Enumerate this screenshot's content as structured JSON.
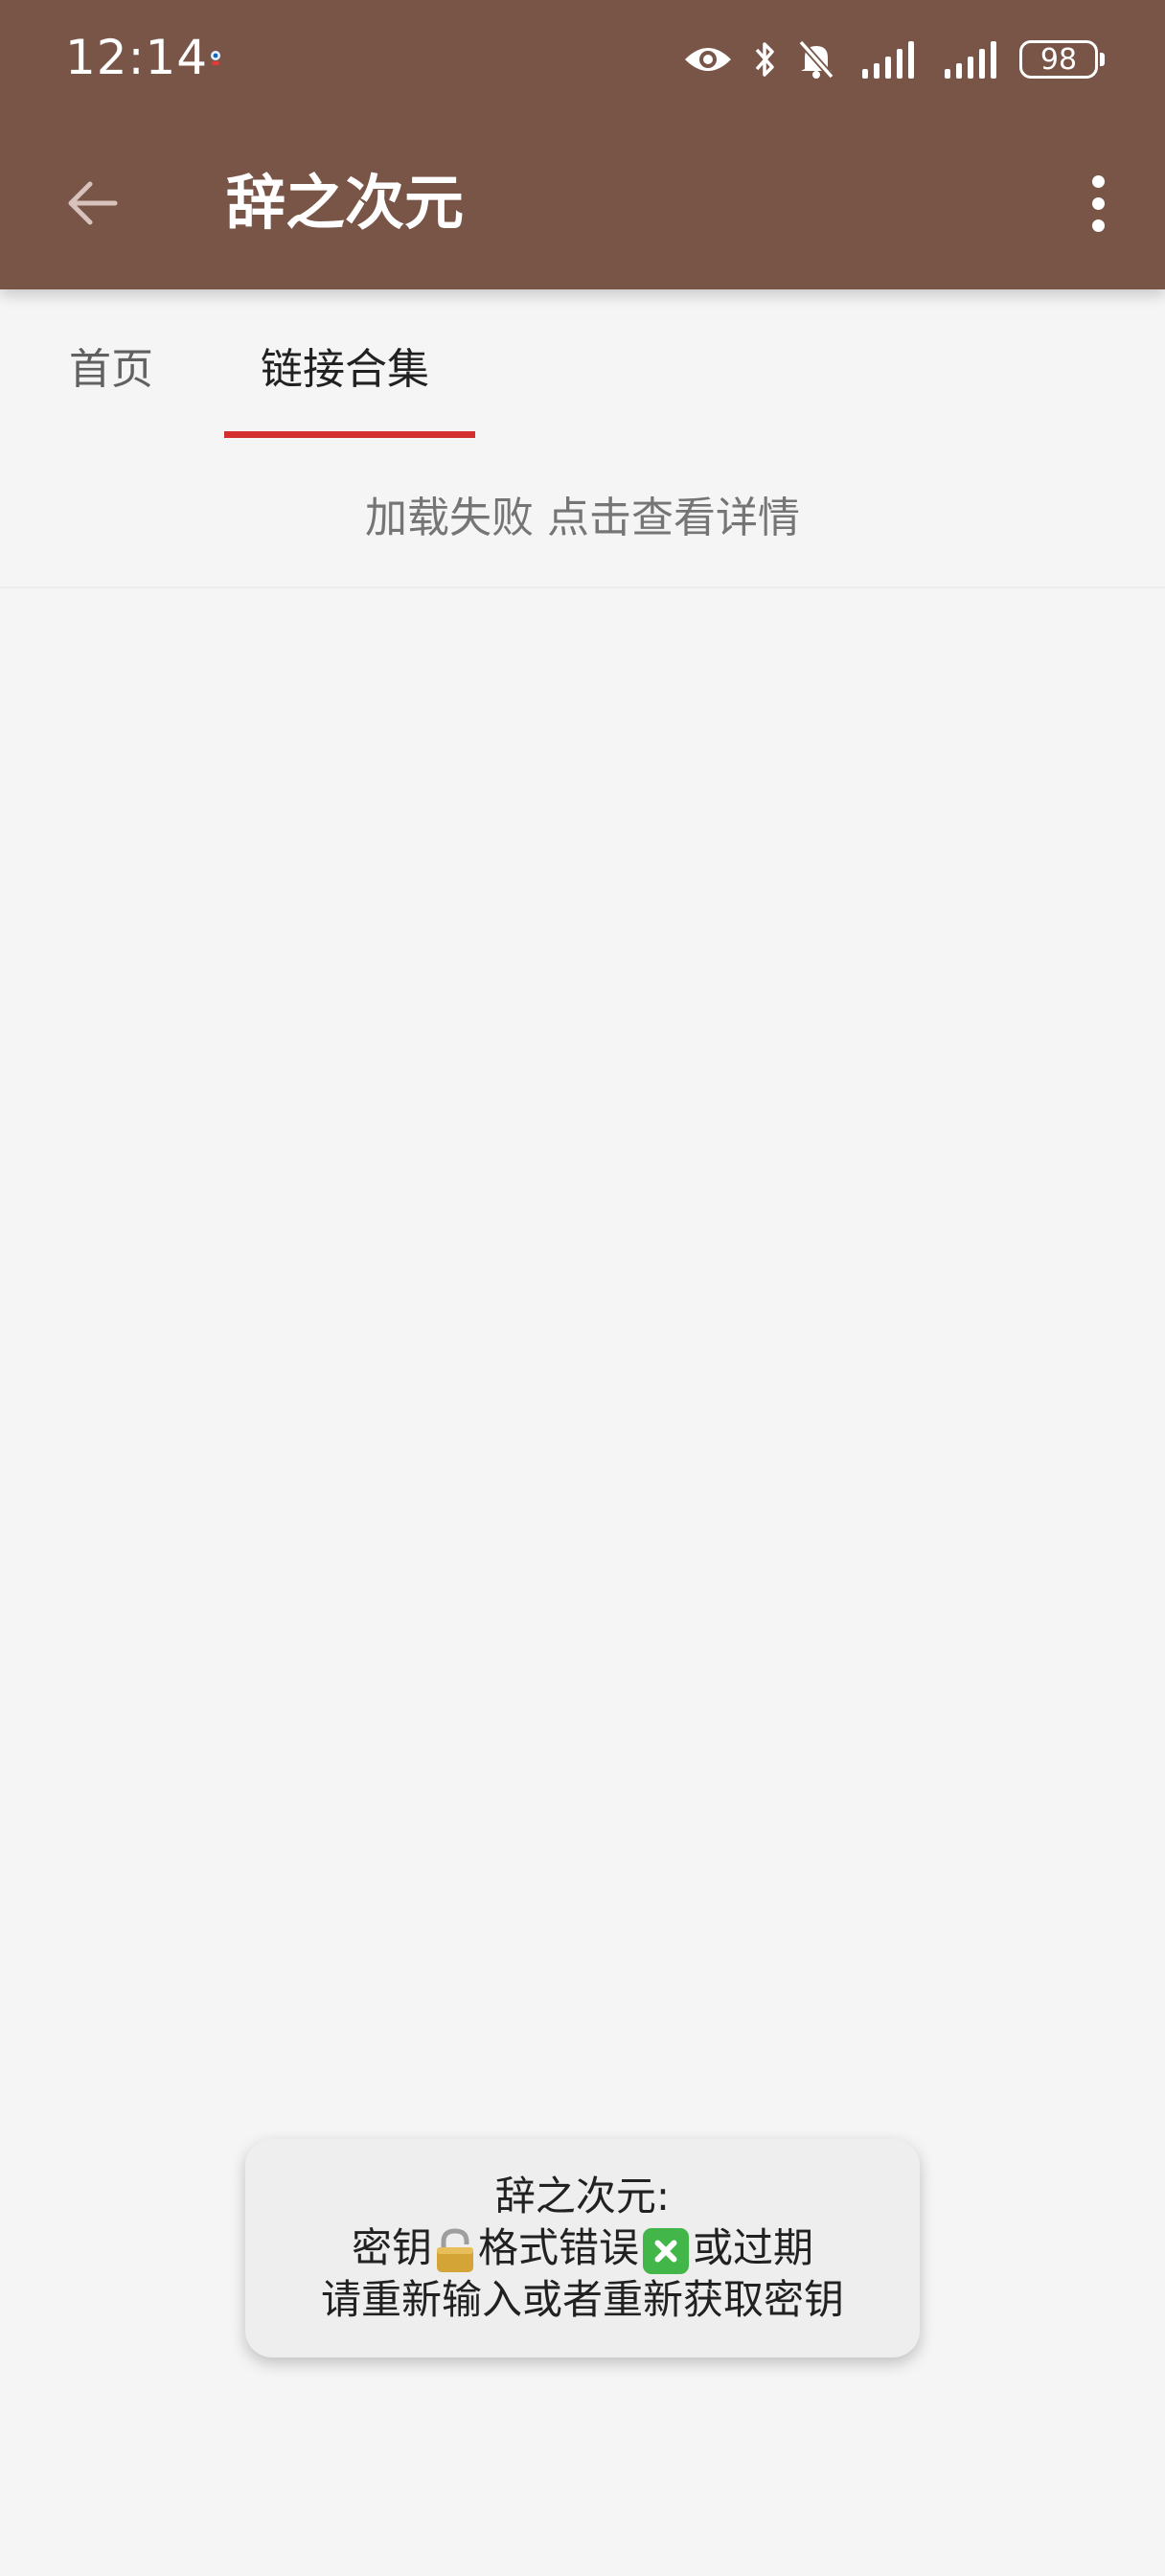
{
  "status_bar": {
    "time": "12:14",
    "battery": "98",
    "icons": [
      "eye-icon",
      "bluetooth-icon",
      "bell-muted-icon",
      "signal-icon",
      "signal-icon"
    ]
  },
  "toolbar": {
    "title": "辞之次元",
    "back_icon": "arrow-left-icon",
    "more_icon": "more-vertical-icon"
  },
  "tabs": [
    {
      "label": "首页",
      "selected": false
    },
    {
      "label": "链接合集",
      "selected": true
    }
  ],
  "content": {
    "load_error": "加载失败 点击查看详情"
  },
  "toast": {
    "line1": "辞之次元:",
    "line2_part1": "密钥",
    "line2_part2": "格式错误",
    "line2_part3": "或过期",
    "line3": "请重新输入或者重新获取密钥"
  },
  "colors": {
    "app_bar": "#795548",
    "tab_indicator": "#d32f2f",
    "background": "#f5f5f5"
  }
}
